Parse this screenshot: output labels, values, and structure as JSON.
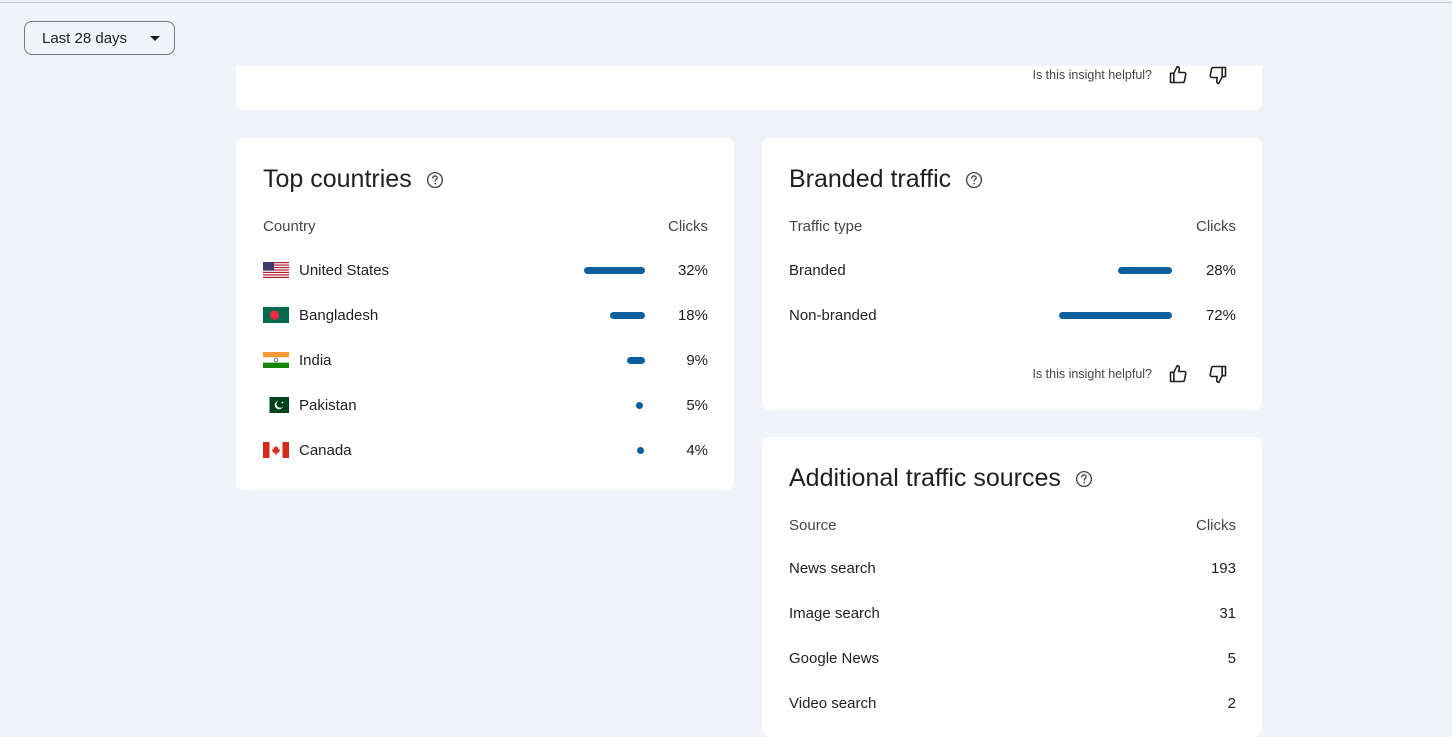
{
  "date_range": {
    "label": "Last 28 days"
  },
  "feedback": {
    "question": "Is this insight helpful?"
  },
  "top_countries": {
    "title": "Top countries",
    "col_left": "Country",
    "col_right": "Clicks",
    "rows": [
      {
        "name": "United States",
        "value": "32%",
        "share": 0.32,
        "flag": "us-flag-icon"
      },
      {
        "name": "Bangladesh",
        "value": "18%",
        "share": 0.18,
        "flag": "bangladesh-flag-icon"
      },
      {
        "name": "India",
        "value": "9%",
        "share": 0.09,
        "flag": "india-flag-icon"
      },
      {
        "name": "Pakistan",
        "value": "5%",
        "share": 0.05,
        "flag": "pakistan-flag-icon"
      },
      {
        "name": "Canada",
        "value": "4%",
        "share": 0.04,
        "flag": "canada-flag-icon"
      }
    ]
  },
  "branded_traffic": {
    "title": "Branded traffic",
    "col_left": "Traffic type",
    "col_right": "Clicks",
    "rows": [
      {
        "name": "Branded",
        "value": "28%",
        "share": 0.28
      },
      {
        "name": "Non-branded",
        "value": "72%",
        "share": 0.72
      }
    ]
  },
  "additional_sources": {
    "title": "Additional traffic sources",
    "col_left": "Source",
    "col_right": "Clicks",
    "rows": [
      {
        "name": "News search",
        "value": "193"
      },
      {
        "name": "Image search",
        "value": "31"
      },
      {
        "name": "Google News",
        "value": "5"
      },
      {
        "name": "Video search",
        "value": "2"
      }
    ]
  },
  "colors": {
    "bar": "#0b5f9e",
    "background": "#f0f4f9",
    "card": "#ffffff"
  }
}
